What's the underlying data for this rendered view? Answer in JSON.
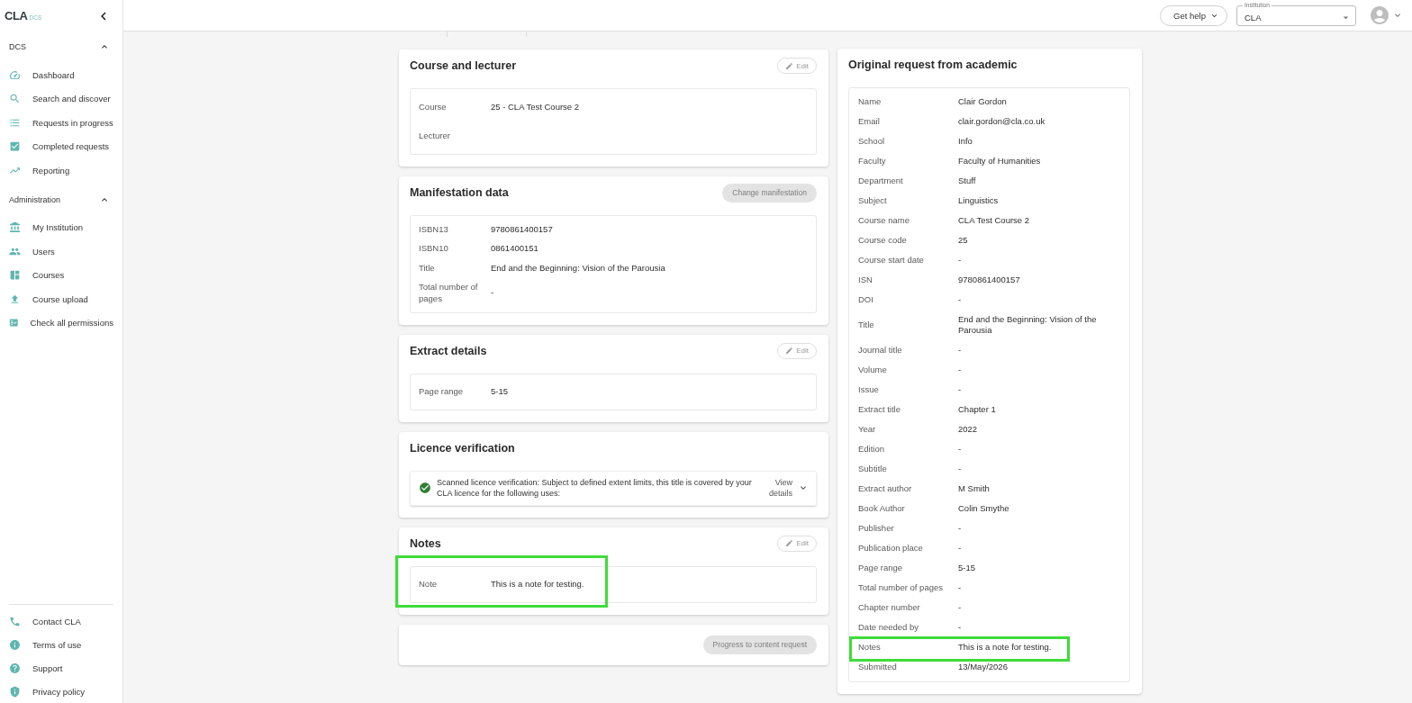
{
  "sidebar": {
    "logo": {
      "wordmark": "CLA",
      "product": "DCS"
    },
    "sections": [
      {
        "title": "DCS",
        "expanded": true,
        "items": [
          "Dashboard",
          "Search and discover",
          "Requests in progress",
          "Completed requests",
          "Reporting"
        ]
      },
      {
        "title": "Administration",
        "expanded": true,
        "items": [
          "My Institution",
          "Users",
          "Courses",
          "Course upload",
          "Check all permissions"
        ]
      }
    ],
    "footer_items": [
      "Contact CLA",
      "Terms of use",
      "Support",
      "Privacy policy"
    ]
  },
  "topbar": {
    "help_button": "Get help",
    "institution": {
      "label": "Institution",
      "value": "CLA"
    }
  },
  "cards": [
    {
      "kind": "course",
      "title": "Course and lecturer",
      "action": {
        "kind": "edit",
        "label": "Edit",
        "disabled": true
      },
      "fields": [
        {
          "label": "Course",
          "value": "25 - CLA Test Course 2",
          "highlighted": false
        },
        {
          "label": "Lecturer",
          "highlighted": false
        }
      ]
    },
    {
      "kind": "fields",
      "title": "Manifestation data",
      "action": {
        "kind": "pill",
        "label": "Change manifestation",
        "disabled": true
      },
      "fields": [
        {
          "label": "ISBN13",
          "value": "9780861400157",
          "highlighted": false
        },
        {
          "label": "ISBN10",
          "value": "0861400151",
          "highlighted": false
        },
        {
          "label": "Title",
          "value": "End and the Beginning: Vision of the Parousia",
          "highlighted": false
        },
        {
          "label": "Total number of pages",
          "value": "-",
          "highlighted": false
        }
      ]
    },
    {
      "kind": "fields",
      "title": "Extract details",
      "action": {
        "kind": "edit",
        "label": "Edit",
        "disabled": true
      },
      "fields": [
        {
          "label": "Page range",
          "value": "5-15",
          "highlighted": false
        }
      ]
    },
    {
      "kind": "licence",
      "title": "Licence verification",
      "verified": true,
      "text": "Scanned licence verification: Subject to defined extent limits, this title is covered by your CLA licence for the following uses:",
      "link": "View details",
      "expanded": false
    },
    {
      "kind": "fields",
      "title": "Notes",
      "action": {
        "kind": "edit",
        "label": "Edit",
        "disabled": true
      },
      "fields": [
        {
          "label": "Note",
          "value": "This is a note for testing.",
          "highlighted": true
        }
      ]
    },
    {
      "kind": "actions",
      "action": {
        "kind": "pill",
        "label": "Progress to content request",
        "disabled": true
      }
    }
  ],
  "request": {
    "title": "Original request from academic",
    "rows": [
      {
        "label": "Name",
        "value": "Clair Gordon",
        "highlighted": false
      },
      {
        "label": "Email",
        "value": "clair.gordon@cla.co.uk",
        "highlighted": false
      },
      {
        "label": "School",
        "value": "Info",
        "highlighted": false
      },
      {
        "label": "Faculty",
        "value": "Faculty of Humanities",
        "highlighted": false
      },
      {
        "label": "Department",
        "value": "Stuff",
        "highlighted": false
      },
      {
        "label": "Subject",
        "value": "Linguistics",
        "highlighted": false
      },
      {
        "label": "Course name",
        "value": "CLA Test Course 2",
        "highlighted": false
      },
      {
        "label": "Course code",
        "value": "25",
        "highlighted": false
      },
      {
        "label": "Course start date",
        "value": "-",
        "highlighted": false
      },
      {
        "label": "ISN",
        "value": "9780861400157",
        "highlighted": false
      },
      {
        "label": "DOI",
        "value": "-",
        "highlighted": false
      },
      {
        "label": "Title",
        "value": "End and the Beginning: Vision of the Parousia",
        "highlighted": false
      },
      {
        "label": "Journal title",
        "value": "-",
        "highlighted": false
      },
      {
        "label": "Volume",
        "value": "-",
        "highlighted": false
      },
      {
        "label": "Issue",
        "value": "-",
        "highlighted": false
      },
      {
        "label": "Extract title",
        "value": "Chapter 1",
        "highlighted": false
      },
      {
        "label": "Year",
        "value": "2022",
        "highlighted": false
      },
      {
        "label": "Edition",
        "value": "-",
        "highlighted": false
      },
      {
        "label": "Subtitle",
        "value": "-",
        "highlighted": false
      },
      {
        "label": "Extract author",
        "value": "M Smith",
        "highlighted": false
      },
      {
        "label": "Book Author",
        "value": "Colin Smythe",
        "highlighted": false
      },
      {
        "label": "Publisher",
        "value": "-",
        "highlighted": false
      },
      {
        "label": "Publication place",
        "value": "-",
        "highlighted": false
      },
      {
        "label": "Page range",
        "value": "5-15",
        "highlighted": false
      },
      {
        "label": "Total number of pages",
        "value": "-",
        "highlighted": false
      },
      {
        "label": "Chapter number",
        "value": "-",
        "highlighted": false
      },
      {
        "label": "Date needed by",
        "value": "-",
        "highlighted": false
      },
      {
        "label": "Notes",
        "value": "This is a note for testing.",
        "highlighted": true
      },
      {
        "label": "Submitted",
        "value": "13/May/2026",
        "highlighted": false
      }
    ]
  }
}
